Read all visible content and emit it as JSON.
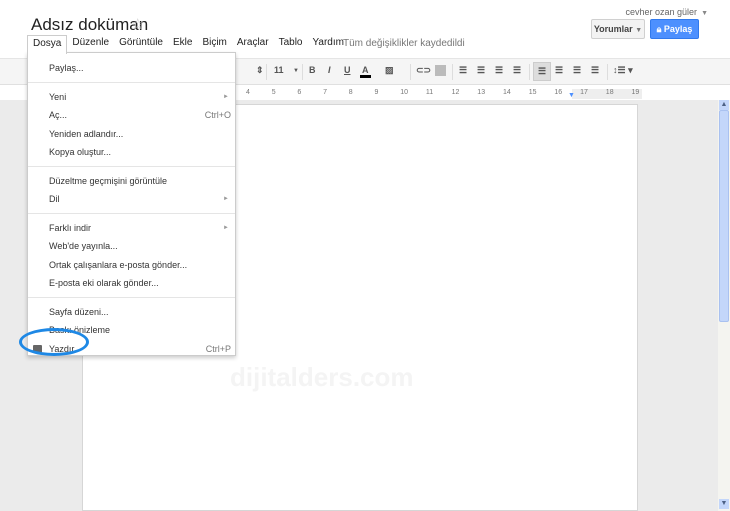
{
  "header": {
    "title": "Adsız doküman",
    "star_icon": "star-outline-icon",
    "user": "cevher ozan güler",
    "comments_label": "Yorumlar",
    "share_label": "Paylaş",
    "share_color": "#4d90fe"
  },
  "menubar": {
    "items": [
      "Dosya",
      "Düzenle",
      "Görüntüle",
      "Ekle",
      "Biçim",
      "Araçlar",
      "Tablo",
      "Yardım"
    ],
    "active": "Dosya",
    "status": "Tüm değişiklikler kaydedildi"
  },
  "toolbar": {
    "font_size": "11",
    "bold": "B",
    "italic": "I",
    "underline": "U",
    "text_color": "A",
    "icons": [
      "link-icon",
      "image-icon",
      "numbered-list-icon",
      "bulleted-list-icon",
      "decrease-indent-icon",
      "increase-indent-icon",
      "align-left-icon",
      "align-center-icon",
      "align-right-icon",
      "justify-icon",
      "line-spacing-icon"
    ]
  },
  "ruler": {
    "numbers": [
      "4",
      "5",
      "6",
      "7",
      "8",
      "9",
      "10",
      "11",
      "12",
      "13",
      "14",
      "15",
      "16",
      "17",
      "18",
      "19"
    ]
  },
  "file_menu": {
    "groups": [
      [
        {
          "label": "Paylaş..."
        }
      ],
      [
        {
          "label": "Yeni",
          "submenu": true
        },
        {
          "label": "Aç...",
          "shortcut": "Ctrl+O"
        },
        {
          "label": "Yeniden adlandır..."
        },
        {
          "label": "Kopya oluştur..."
        }
      ],
      [
        {
          "label": "Düzeltme geçmişini görüntüle"
        },
        {
          "label": "Dil",
          "submenu": true
        }
      ],
      [
        {
          "label": "Farklı indir",
          "submenu": true
        },
        {
          "label": "Web'de yayınla..."
        },
        {
          "label": "Ortak çalışanlara e-posta gönder..."
        },
        {
          "label": "E-posta eki olarak gönder..."
        }
      ],
      [
        {
          "label": "Sayfa düzeni..."
        },
        {
          "label": "Baskı önizleme"
        },
        {
          "label": "Yazdır",
          "shortcut": "Ctrl+P",
          "icon": "printer-icon",
          "highlighted": true
        }
      ]
    ]
  },
  "watermark": "dijitalders.com",
  "highlight_color": "#1e88e5"
}
